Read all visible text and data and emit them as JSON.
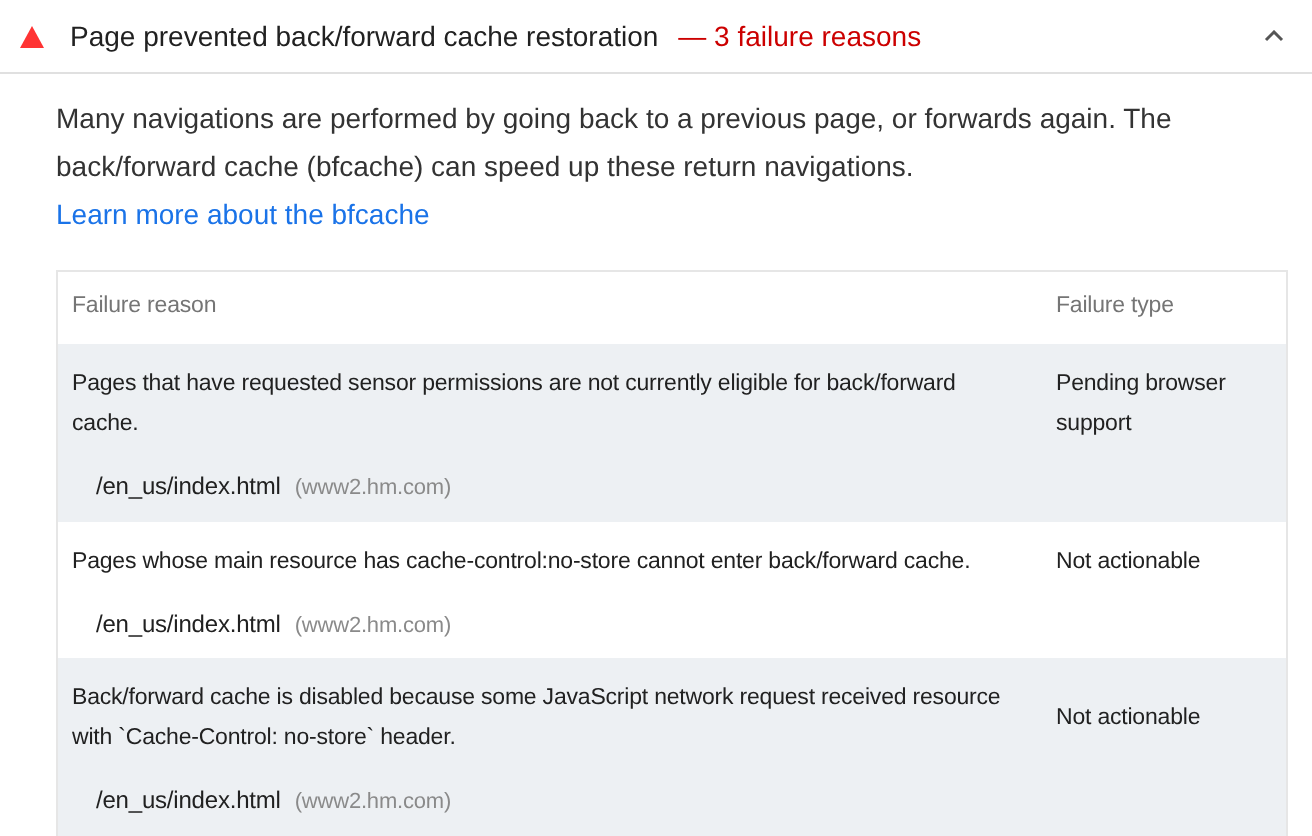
{
  "audit": {
    "title": "Page prevented back/forward cache restoration",
    "summary": "— 3 failure reasons",
    "expanded": true
  },
  "description": {
    "text": "Many navigations are performed by going back to a previous page, or forwards again. The back/forward cache (bfcache) can speed up these return navigations.",
    "link": "Learn more about the bfcache"
  },
  "table": {
    "columns": [
      "Failure reason",
      "Failure type"
    ],
    "rows": [
      {
        "reason": "Pages that have requested sensor permissions are not currently eligible for back/forward cache.",
        "type": "Pending browser support",
        "url": "/en_us/index.html",
        "host": "(www2.hm.com)"
      },
      {
        "reason": "Pages whose main resource has cache-control:no-store cannot enter back/forward cache.",
        "type": "Not actionable",
        "url": "/en_us/index.html",
        "host": "(www2.hm.com)"
      },
      {
        "reason": "Back/forward cache is disabled because some JavaScript network request received resource with `Cache-Control: no-store` header.",
        "type": "Not actionable",
        "url": "/en_us/index.html",
        "host": "(www2.hm.com)"
      }
    ]
  }
}
